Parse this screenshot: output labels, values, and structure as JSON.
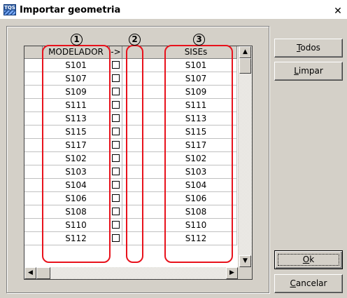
{
  "window": {
    "title": "Importar geometria",
    "app_icon_text": "TQS"
  },
  "annotations": [
    "1",
    "2",
    "3"
  ],
  "grid": {
    "columns": [
      "MODELADOR",
      "->",
      "SISEs"
    ],
    "rows": [
      {
        "modelador": "S101",
        "sises": "S101"
      },
      {
        "modelador": "S107",
        "sises": "S107"
      },
      {
        "modelador": "S109",
        "sises": "S109"
      },
      {
        "modelador": "S111",
        "sises": "S111"
      },
      {
        "modelador": "S113",
        "sises": "S113"
      },
      {
        "modelador": "S115",
        "sises": "S115"
      },
      {
        "modelador": "S117",
        "sises": "S117"
      },
      {
        "modelador": "S102",
        "sises": "S102"
      },
      {
        "modelador": "S103",
        "sises": "S103"
      },
      {
        "modelador": "S104",
        "sises": "S104"
      },
      {
        "modelador": "S106",
        "sises": "S106"
      },
      {
        "modelador": "S108",
        "sises": "S108"
      },
      {
        "modelador": "S110",
        "sises": "S110"
      },
      {
        "modelador": "S112",
        "sises": "S112"
      }
    ]
  },
  "buttons": {
    "todos": {
      "mnemonic": "T",
      "rest": "odos"
    },
    "limpar": {
      "mnemonic": "L",
      "rest": "impar"
    },
    "ok": {
      "mnemonic": "O",
      "rest": "k"
    },
    "cancelar": {
      "mnemonic": "C",
      "rest": "ancelar"
    }
  },
  "colors": {
    "annotation": "#e8121c",
    "dialog_bg": "#d4d0c8"
  }
}
